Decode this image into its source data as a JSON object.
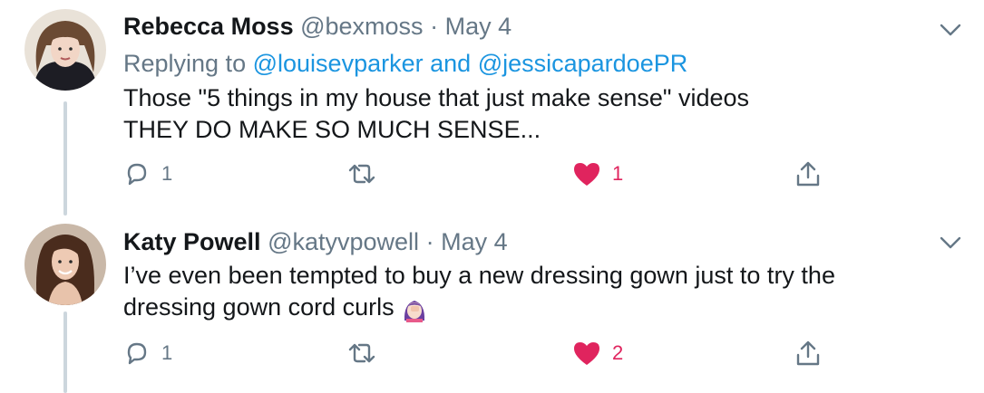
{
  "tweets": [
    {
      "name": "Rebecca Moss",
      "handle": "@bexmoss",
      "separator": "·",
      "date": "May 4",
      "replying_prefix": "Replying to",
      "reply_to_1": "@louisevparker",
      "reply_and": "and",
      "reply_to_2": "@jessicapardoePR",
      "text_line1": "Those \"5 things in my house that just make sense\" videos",
      "text_line2": "THEY DO MAKE SO MUCH SENSE...",
      "reply_count": "1",
      "like_count": "1",
      "liked": true,
      "avatar_icon": "avatar-woman-bangs"
    },
    {
      "name": "Katy Powell",
      "handle": "@katyvpowell",
      "separator": "·",
      "date": "May 4",
      "text_line1": "I’ve even been tempted to buy a new dressing gown just to try the",
      "text_line2": "dressing gown cord curls",
      "emoji_icon": "woman-facepalming-emoji",
      "reply_count": "1",
      "like_count": "2",
      "liked": true,
      "avatar_icon": "avatar-woman-long-hair"
    }
  ],
  "colors": {
    "accent_link": "#1b95e0",
    "like_red": "#e0245e",
    "secondary_text": "#657786",
    "thread_line": "#ccd6dd"
  }
}
